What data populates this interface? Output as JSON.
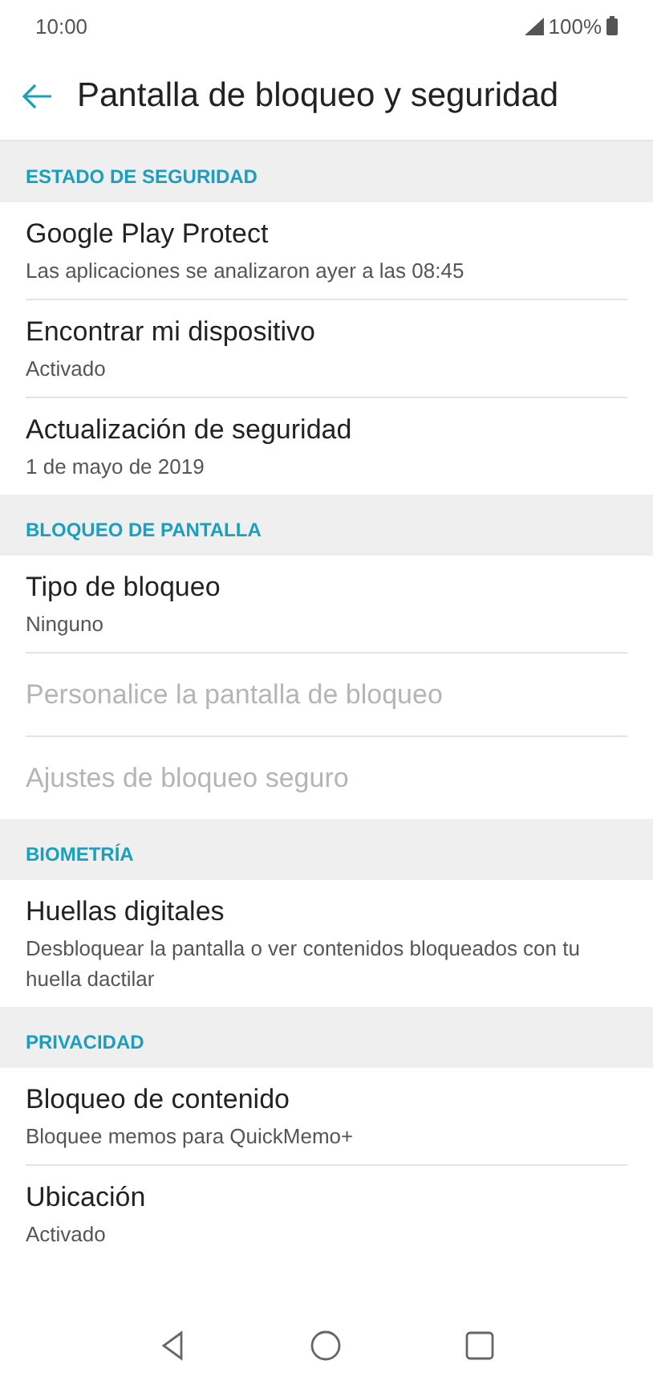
{
  "status_bar": {
    "time": "10:00",
    "battery": "100%"
  },
  "app_bar": {
    "title": "Pantalla de bloqueo y seguridad"
  },
  "sections": [
    {
      "header": "ESTADO DE SEGURIDAD",
      "items": [
        {
          "title": "Google Play Protect",
          "subtitle": "Las aplicaciones se analizaron ayer a las 08:45",
          "disabled": false
        },
        {
          "title": "Encontrar mi dispositivo",
          "subtitle": "Activado",
          "disabled": false
        },
        {
          "title": "Actualización de seguridad",
          "subtitle": "1 de mayo de 2019",
          "disabled": false
        }
      ]
    },
    {
      "header": "BLOQUEO DE PANTALLA",
      "items": [
        {
          "title": "Tipo de bloqueo",
          "subtitle": "Ninguno",
          "disabled": false
        },
        {
          "title": "Personalice la pantalla de bloqueo",
          "disabled": true
        },
        {
          "title": "Ajustes de bloqueo seguro",
          "disabled": true
        }
      ]
    },
    {
      "header": "BIOMETRÍA",
      "items": [
        {
          "title": "Huellas digitales",
          "subtitle": "Desbloquear la pantalla o ver contenidos bloqueados con tu huella dactilar",
          "disabled": false
        }
      ]
    },
    {
      "header": "PRIVACIDAD",
      "items": [
        {
          "title": "Bloqueo de contenido",
          "subtitle": "Bloquee memos para QuickMemo+",
          "disabled": false
        },
        {
          "title": "Ubicación",
          "subtitle": "Activado",
          "disabled": false
        }
      ]
    }
  ]
}
